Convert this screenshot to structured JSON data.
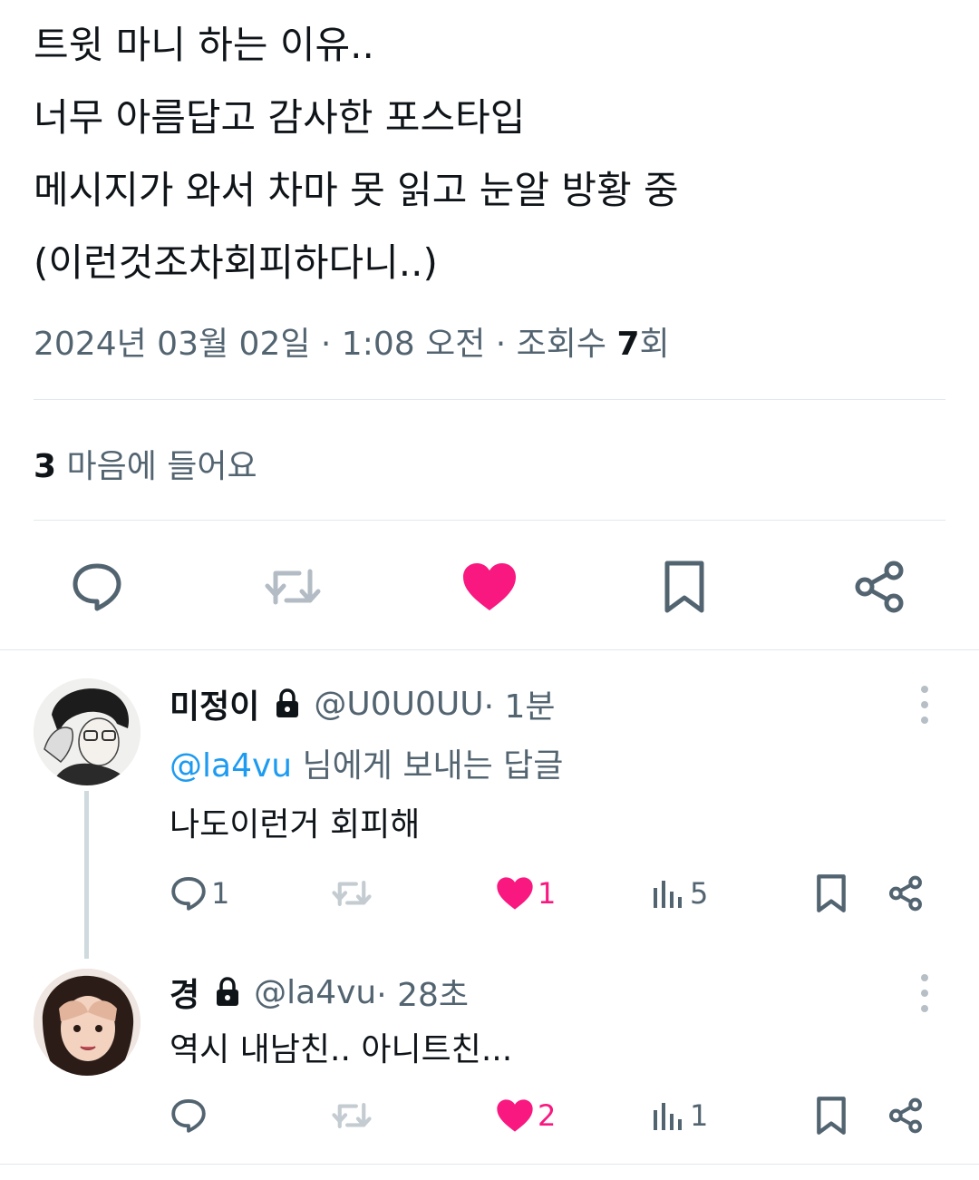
{
  "tweet": {
    "lines": [
      "트윗 마니 하는 이유..",
      "너무 아름답고 감사한 포스타입",
      "메시지가 와서 차마 못 읽고 눈알 방황 중",
      "(이런것조차회피하다니..)"
    ],
    "meta_prefix": "2024년 03월 02일 · 1:08 오전 · 조회수 ",
    "views_count": "7",
    "views_suffix": "회",
    "likes_count": "3",
    "likes_label": " 마음에 들어요"
  },
  "actions": {
    "icons": [
      "comment-icon",
      "retweet-icon",
      "heart-filled-icon",
      "bookmark-icon",
      "share-icon"
    ]
  },
  "replies": [
    {
      "name": "미정이",
      "handle": "@U0U0UU",
      "time": " · 1분",
      "replying_prefix": "@la4vu",
      "replying_suffix": " 님에게 보내는 답글",
      "text": "나도이런거 회피해",
      "comments": "1",
      "retweets": "",
      "likes": "1",
      "views": "5"
    },
    {
      "name": "경",
      "handle": "@la4vu",
      "time": " · 28초",
      "text": "역시 내남친.. 아니트친...",
      "comments": "",
      "retweets": "",
      "likes": "2",
      "views": "1"
    }
  ],
  "colors": {
    "text": "#0f1419",
    "secondary": "#536471",
    "like_pink": "#f91880",
    "link_blue": "#1d9bf0",
    "divider": "#e1e8ed"
  }
}
